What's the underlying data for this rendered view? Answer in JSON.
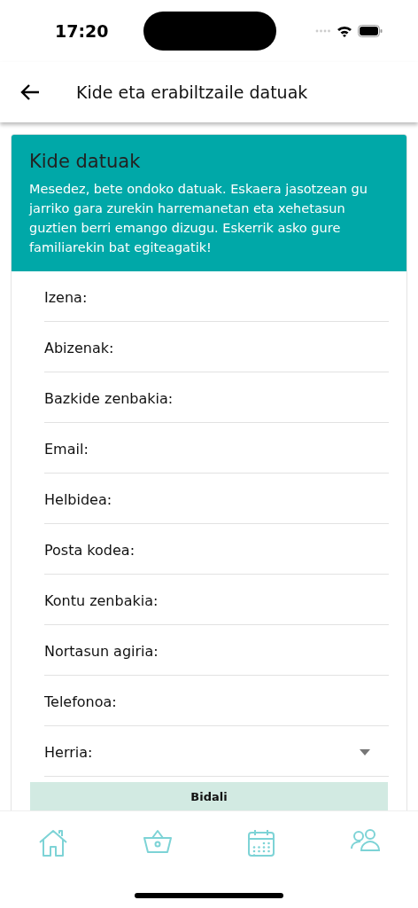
{
  "status_bar": {
    "time": "17:20"
  },
  "header": {
    "title": "Kide eta erabiltzaile datuak"
  },
  "card": {
    "title": "Kide datuak",
    "description": "Mesedez, bete ondoko datuak. Eskaera jasotzean gu jarriko gara zurekin harremanetan eta xehetasun guztien berri emango dizugu. Eskerrik asko gure familiarekin bat egiteagatik!"
  },
  "fields": [
    {
      "kind": "text",
      "label": "Izena:"
    },
    {
      "kind": "text",
      "label": "Abizenak:"
    },
    {
      "kind": "text",
      "label": "Bazkide zenbakia:"
    },
    {
      "kind": "text",
      "label": "Email:"
    },
    {
      "kind": "text",
      "label": "Helbidea:"
    },
    {
      "kind": "text",
      "label": "Posta kodea:"
    },
    {
      "kind": "text",
      "label": "Kontu zenbakia:"
    },
    {
      "kind": "text",
      "label": "Nortasun agiria:"
    },
    {
      "kind": "text",
      "label": "Telefonoa:"
    },
    {
      "kind": "select",
      "label": "Herria:"
    }
  ],
  "submit_button": {
    "label": "Bidali"
  },
  "bottom_nav": [
    {
      "kind": "home"
    },
    {
      "kind": "basket"
    },
    {
      "kind": "calendar"
    },
    {
      "kind": "people"
    }
  ]
}
